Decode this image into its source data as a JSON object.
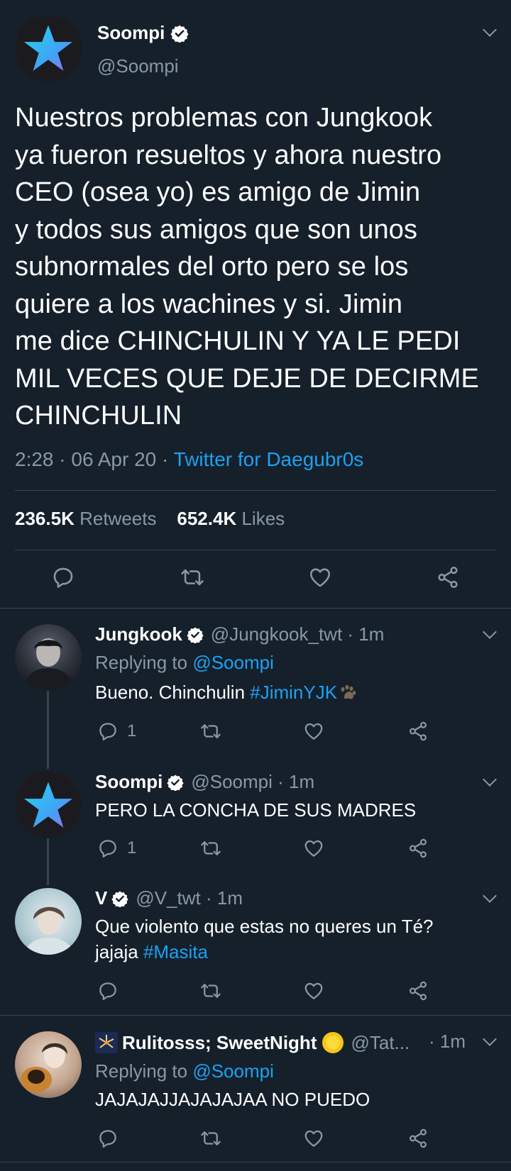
{
  "main_tweet": {
    "name": "Soompi",
    "handle": "@Soompi",
    "text_lines": [
      "Nuestros problemas con Jungkook",
      "ya fueron resueltos y ahora nuestro",
      "CEO (osea yo) es amigo de Jimin",
      "y todos sus amigos que son unos",
      "subnormales del orto pero se los",
      "quiere a los wachines y si. Jimin",
      "me dice CHINCHULIN Y YA LE PEDI",
      "MIL VECES QUE DEJE DE DECIRME",
      "CHINCHULIN"
    ],
    "time": "2:28 · 06 Apr 20 · ",
    "source": "Twitter for Daegubr0s",
    "retweets_count": "236.5K",
    "retweets_label": "Retweets",
    "likes_count": "652.4K",
    "likes_label": "Likes"
  },
  "replies": [
    {
      "name": "Jungkook",
      "handle": "@Jungkook_twt · 1m",
      "replying_prefix": "Replying to ",
      "replying_to": "@Soompi",
      "text": "Bueno. Chinchulin ",
      "hashtag": "#JiminYJK",
      "reply_count": "1"
    },
    {
      "name": "Soompi",
      "handle": "@Soompi · 1m",
      "text": "PERO LA CONCHA DE SUS MADRES",
      "reply_count": "1"
    },
    {
      "name": "V",
      "handle": "@V_twt · 1m",
      "text_line1": "Que violento que estas no queres un Té?",
      "text_line2": "jajaja ",
      "hashtag": "#Masita"
    },
    {
      "name": "Rulitosss; SweetNight",
      "handle": "@Tat...",
      "time": "· 1m",
      "replying_prefix": "Replying to ",
      "replying_to": "@Soompi",
      "text": "JAJAJAJJAJAJAJAA NO PUEDO"
    }
  ],
  "icons": [
    "star-logo-icon",
    "verified-icon",
    "chevron-down-icon",
    "reply-icon",
    "retweet-icon",
    "like-icon",
    "share-icon",
    "paw-icon",
    "firework-icon",
    "sun-emoji-icon"
  ],
  "colors": {
    "background": "#15202b",
    "accent": "#1da1f2",
    "secondary_text": "#8899a6",
    "divider": "#38444d"
  }
}
